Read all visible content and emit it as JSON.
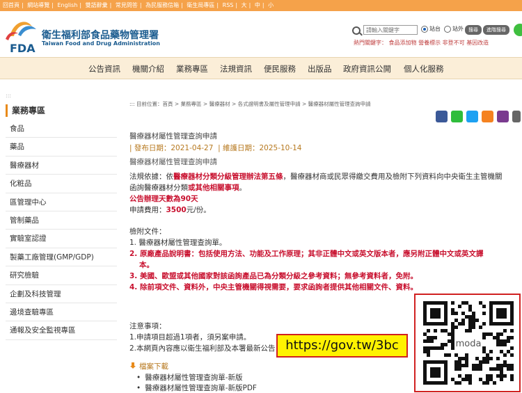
{
  "topbar": {
    "links": [
      "回首頁",
      "網站導覽",
      "English",
      "雙語辭彙",
      "常見問答",
      "為民服務信箱",
      "衛生局專區",
      "RSS",
      "大",
      "中",
      "小"
    ]
  },
  "header": {
    "title_zh": "衛生福利部食品藥物管理署",
    "title_en": "Taiwan Food and Drug Administration",
    "logo_text": "FDA",
    "search_placeholder": "請輸入關鍵字",
    "radio_site": "站台",
    "radio_out": "站外",
    "search_btn": "搜尋",
    "adv_btn": "進階搜尋",
    "hot_label": "熱門關鍵字：",
    "hot_keywords": [
      "食品添加物",
      "營養標示",
      "非登不可",
      "基因改造"
    ]
  },
  "nav": {
    "items": [
      "公告資訊",
      "機關介紹",
      "業務專區",
      "法規資訊",
      "便民服務",
      "出版品",
      "政府資訊公開",
      "個人化服務"
    ]
  },
  "sidebar": {
    "dots": ":::",
    "title": "業務專區",
    "items": [
      "食品",
      "藥品",
      "醫療器材",
      "化粧品",
      "區管理中心",
      "管制藥品",
      "實驗室認證",
      "製藥工廠管理(GMP/GDP)",
      "研究檢驗",
      "企劃及科技管理",
      "邊境查驗專區",
      "通報及安全監視專區"
    ]
  },
  "content": {
    "breadcrumb": "::: 目前位置：首頁 > 業務專區 > 醫療器材 > 各式證明書及屬性管理申請 > 醫療器材屬性管理查詢申請",
    "page_title": "醫療器材屬性管理查詢申請",
    "publish": "| 發布日期：2021-04-27",
    "maintain": "| 維護日期：2025-10-14",
    "subtitle": "醫療器材屬性管理查詢申請",
    "law_prefix": "法規依據：依",
    "law_bold": "醫療器材分類分級管理辦法第五條",
    "law_suffix": "，醫療器材商或民眾得繳交費用及檢附下列資料向中央衛生主管機關",
    "law_line2_prefix": "函詢醫療器材分類",
    "law_line2_bold": "或其他相關事項",
    "law_line2_end": "。",
    "days": "公告辦理天數為90天",
    "fee_prefix": "申請費用：",
    "fee_amount": "3500",
    "fee_suffix": "元/份。",
    "attach_title": "檢附文件：",
    "attach_1": "1. 醫療器材屬性管理查詢單。",
    "attach_2a": "2. 原廠產品說明書：",
    "attach_2b": "包括使用方法、功能及工作原理；其非正體中文或英文版本者，應另附正體中文或英文譯",
    "attach_2c": "本。",
    "attach_3": "3. 美國、歐盟或其他國家對該函詢產品已為分類分級之參考資料；無參考資料者，免附。",
    "attach_4": "4. 除前項文件、資料外，中央主管機關得視需要，要求函詢者提供其他相關文件、資料。",
    "notes_title": "注意事項：",
    "note_1": "1.申請項目超過1項者，須另案申請。",
    "note_2": "2.本網頁內容應以衛生福利部及本署最新公告",
    "download_title": "檔案下載",
    "downloads": [
      "醫療器材屬性管理查詢單-新版",
      "醫療器材屬性管理查詢單-新版PDF"
    ]
  },
  "overlay": {
    "url": "https://gov.tw/3bc",
    "qr_center_label": "moda"
  },
  "colors": {
    "topbar": "#f5a24a",
    "nav_bg": "#fbeed8",
    "accent_orange": "#e88a1a",
    "red": "#c8102e",
    "date_gold": "#b7791f",
    "url_box": "#fff200"
  }
}
